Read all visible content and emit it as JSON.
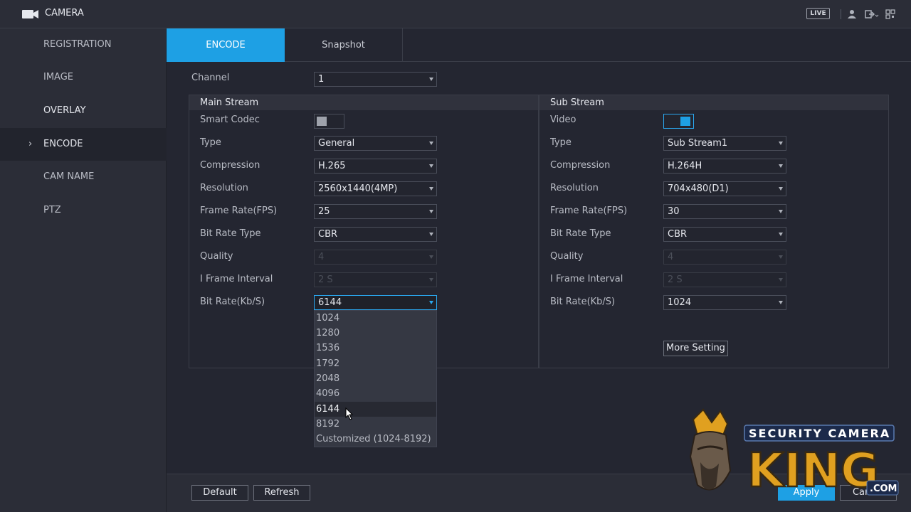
{
  "header": {
    "title": "CAMERA",
    "live_badge": "LIVE",
    "icons": [
      "camera-icon",
      "user-icon",
      "logout-icon",
      "qr-icon"
    ]
  },
  "sidebar": {
    "items": [
      {
        "label": "REGISTRATION",
        "active": false
      },
      {
        "label": "IMAGE",
        "active": false
      },
      {
        "label": "OVERLAY",
        "active": false
      },
      {
        "label": "ENCODE",
        "active": true
      },
      {
        "label": "CAM NAME",
        "active": false
      },
      {
        "label": "PTZ",
        "active": false
      }
    ]
  },
  "tabs": [
    {
      "label": "ENCODE",
      "active": true
    },
    {
      "label": "Snapshot",
      "active": false
    }
  ],
  "channel": {
    "label": "Channel",
    "value": "1"
  },
  "main_stream": {
    "title": "Main Stream",
    "smart_codec": {
      "label": "Smart Codec",
      "on": false
    },
    "type": {
      "label": "Type",
      "value": "General"
    },
    "compression": {
      "label": "Compression",
      "value": "H.265"
    },
    "resolution": {
      "label": "Resolution",
      "value": "2560x1440(4MP)"
    },
    "frame_rate": {
      "label": "Frame Rate(FPS)",
      "value": "25"
    },
    "bit_rate_type": {
      "label": "Bit Rate Type",
      "value": "CBR"
    },
    "quality": {
      "label": "Quality",
      "value": "4"
    },
    "iframe": {
      "label": "I Frame Interval",
      "value": "2 S"
    },
    "bit_rate": {
      "label": "Bit Rate(Kb/S)",
      "value": "6144"
    }
  },
  "bitrate_options": [
    "1024",
    "1280",
    "1536",
    "1792",
    "2048",
    "4096",
    "6144",
    "8192",
    "Customized (1024-8192)"
  ],
  "bitrate_selected": "6144",
  "sub_stream": {
    "title": "Sub Stream",
    "video": {
      "label": "Video",
      "on": true
    },
    "type": {
      "label": "Type",
      "value": "Sub Stream1"
    },
    "compression": {
      "label": "Compression",
      "value": "H.264H"
    },
    "resolution": {
      "label": "Resolution",
      "value": "704x480(D1)"
    },
    "frame_rate": {
      "label": "Frame Rate(FPS)",
      "value": "30"
    },
    "bit_rate_type": {
      "label": "Bit Rate Type",
      "value": "CBR"
    },
    "quality": {
      "label": "Quality",
      "value": "4"
    },
    "iframe": {
      "label": "I Frame Interval",
      "value": "2 S"
    },
    "bit_rate": {
      "label": "Bit Rate(Kb/S)",
      "value": "1024"
    },
    "more_setting": "More Setting"
  },
  "buttons": {
    "default": "Default",
    "refresh": "Refresh",
    "apply": "Apply",
    "cancel": "Cancel"
  },
  "watermark": {
    "line1": "SECURITY CAMERA",
    "line2": "KING",
    ".com": ".COM"
  },
  "colors": {
    "accent": "#1ea0e4",
    "background": "#242631",
    "panel": "#2b2d37"
  }
}
